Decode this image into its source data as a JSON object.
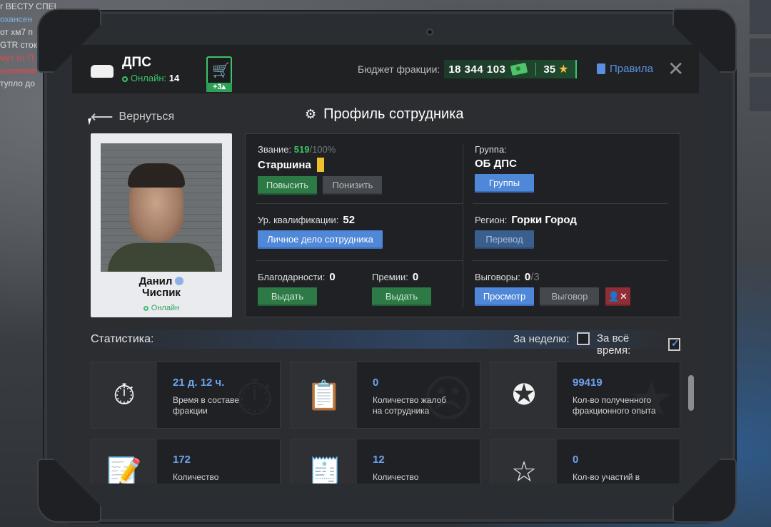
{
  "background": {
    "chat_lines": [
      {
        "text": "г ВЕСТУ СПЕЦ",
        "color": "#d9d9d9"
      },
      {
        "text": "охансен",
        "color": "#7fb0e0"
      },
      {
        "text": "от хм7 п",
        "color": "#d9d9d9"
      },
      {
        "text": "",
        "color": "#d9d9d9"
      },
      {
        "text": "GTR сток",
        "color": "#d9d9d9"
      },
      {
        "text": "мут от П",
        "color": "#e04a4a"
      },
      {
        "text": "щениями",
        "color": "#e04a4a"
      },
      {
        "text": "",
        "color": "#d9d9d9"
      },
      {
        "text": "",
        "color": "#d9d9d9"
      },
      {
        "text": "тупло до",
        "color": "#d9d9d9"
      }
    ]
  },
  "header": {
    "dept_name": "ДПС",
    "online_label": "Онлайн:",
    "online_count": "14",
    "shop_badge": "+3",
    "budget_label": "Бюджет фракции:",
    "budget_amount": "18 344 103",
    "stars": "35",
    "rules_label": "Правила",
    "close_symbol": "✕"
  },
  "nav": {
    "back_label": "Вернуться",
    "page_title": "Профиль сотрудника"
  },
  "employee": {
    "first_name": "Данил",
    "last_name": "Чиспик",
    "status": "Онлайн"
  },
  "profile": {
    "rank_label": "Звание:",
    "rank_progress": "519",
    "rank_max": "/100%",
    "rank_name": "Старшина",
    "promote_btn": "Повысить",
    "demote_btn": "Понизить",
    "group_label": "Группа:",
    "group_name": "ОБ ДПС",
    "groups_btn": "Группы",
    "qual_label": "Ур. квалификации:",
    "qual_value": "52",
    "personal_file_btn": "Личное дело сотрудника",
    "region_label": "Регион:",
    "region_value": "Горки Город",
    "transfer_btn": "Перевод",
    "thanks_label": "Благодарности:",
    "thanks_value": "0",
    "thanks_btn": "Выдать",
    "bonus_label": "Премии:",
    "bonus_value": "0",
    "bonus_btn": "Выдать",
    "warns_label": "Выговоры:",
    "warns_value": "0",
    "warns_max": "/3",
    "view_btn": "Просмотр",
    "warn_btn": "Выговор"
  },
  "stats": {
    "title": "Статистика:",
    "week_label": "За неделю:",
    "week_checked": false,
    "alltime_label": "За всё время:",
    "alltime_checked": true,
    "cards": [
      {
        "value": "21 д. 12 ч.",
        "desc1": "Время в составе",
        "desc2": "фракции",
        "icon": "stopwatch-icon"
      },
      {
        "value": "0",
        "desc1": "Количество жалоб",
        "desc2": "на сотрудника",
        "icon": "complaint-icon"
      },
      {
        "value": "99419",
        "desc1": "Кол-во полученного",
        "desc2": "фракционного опыта",
        "icon": "exp-icon"
      },
      {
        "value": "172",
        "desc1": "Количество",
        "desc2": "",
        "icon": "clipboard-icon"
      },
      {
        "value": "12",
        "desc1": "Количество",
        "desc2": "",
        "icon": "receipt-icon"
      },
      {
        "value": "0",
        "desc1": "Кол-во участий в",
        "desc2": "",
        "icon": "star-icon"
      }
    ]
  }
}
